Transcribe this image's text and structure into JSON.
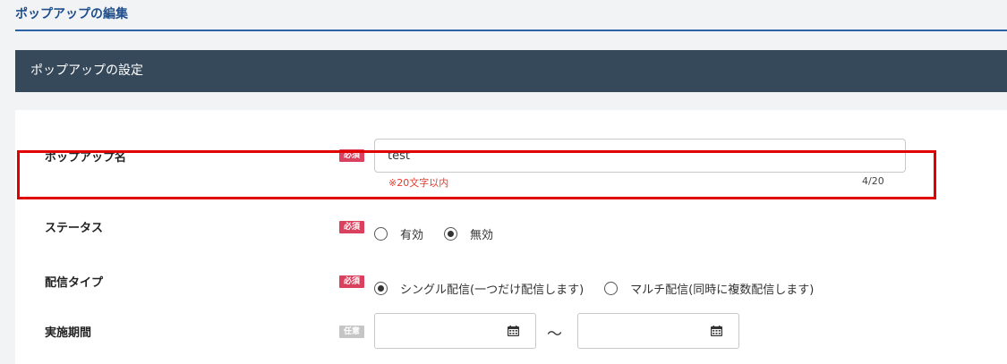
{
  "page": {
    "title": "ポップアップの編集"
  },
  "section": {
    "title": "ポップアップの設定"
  },
  "badges": {
    "required": "必須",
    "optional": "任意"
  },
  "fields": {
    "popup_name": {
      "label": "ポップアップ名",
      "value": "test",
      "hint": "※20文字以内",
      "counter": "4/20"
    },
    "status": {
      "label": "ステータス",
      "options": [
        {
          "label": "有効",
          "checked": false
        },
        {
          "label": "無効",
          "checked": true
        }
      ]
    },
    "delivery_type": {
      "label": "配信タイプ",
      "options": [
        {
          "label": "シングル配信(一つだけ配信します)",
          "checked": true
        },
        {
          "label": "マルチ配信(同時に複数配信します)",
          "checked": false
        }
      ]
    },
    "period": {
      "label": "実施期間",
      "start": "",
      "end": "",
      "separator": "～"
    }
  },
  "icons": {
    "calendar": "calendar-icon"
  },
  "colors": {
    "accent_blue": "#1f4e8c",
    "header_bg": "#36495a",
    "required_badge": "#d9415e",
    "optional_badge": "#c5c5c5",
    "hint_red": "#e43a2b",
    "highlight_red": "#e00000"
  }
}
